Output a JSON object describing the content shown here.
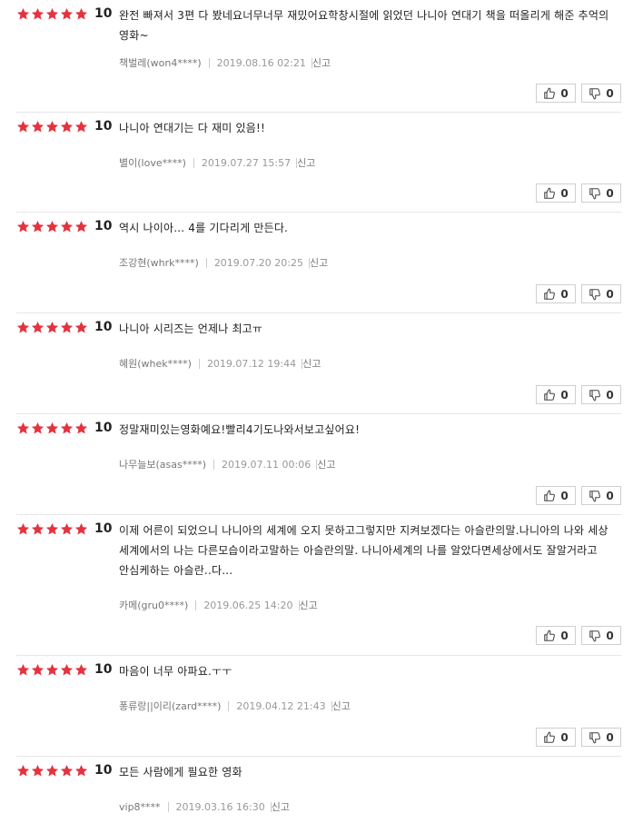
{
  "colors": {
    "star": "#e4333f",
    "score": "#222222",
    "text": "#222222",
    "meta": "#777777",
    "border": "#e6e6e6"
  },
  "reviews": [
    {
      "stars": 5,
      "score": "10",
      "text": "완전 빠져서 3편 다 봤네요너무너무 재밌어요학창시절에 읽었던 나니아 연대기 책을 떠올리게 해준 추억의 영화~",
      "user": "책벌레(won4****)",
      "date": "2019.08.16 02:21",
      "report": "신고",
      "likes": "0",
      "dislikes": "0"
    },
    {
      "stars": 5,
      "score": "10",
      "text": "나니아 연대기는 다 재미 있음!!",
      "user": "별이(love****)",
      "date": "2019.07.27 15:57",
      "report": "신고",
      "likes": "0",
      "dislikes": "0"
    },
    {
      "stars": 5,
      "score": "10",
      "text": "역시 나이아... 4를 기다리게 만든다.",
      "user": "조강현(whrk****)",
      "date": "2019.07.20 20:25",
      "report": "신고",
      "likes": "0",
      "dislikes": "0"
    },
    {
      "stars": 5,
      "score": "10",
      "text": "나니아 시리즈는 언제나 최고ㅠ",
      "user": "혜원(whek****)",
      "date": "2019.07.12 19:44",
      "report": "신고",
      "likes": "0",
      "dislikes": "0"
    },
    {
      "stars": 5,
      "score": "10",
      "text": "정말재미있는영화예요!빨리4기도나와서보고싶어요!",
      "user": "나무늘보(asas****)",
      "date": "2019.07.11 00:06",
      "report": "신고",
      "likes": "0",
      "dislikes": "0"
    },
    {
      "stars": 5,
      "score": "10",
      "text": "이제 어른이 되었으니 나니아의 세계에 오지 못하고그렇지만 지켜보겠다는 아슬란의말.나니아의 나와 세상세계에서의 나는 다른모습이라고말하는 아슬란의말. 나니아세계의 나를 알았다면세상에서도 잘알거라고 안심케하는 아슬란..다...",
      "user": "카메(gru0****)",
      "date": "2019.06.25 14:20",
      "report": "신고",
      "likes": "0",
      "dislikes": "0"
    },
    {
      "stars": 5,
      "score": "10",
      "text": "마음이 너무 아파요.ㅜㅜ",
      "user": "퐁류랑||이리(zard****)",
      "date": "2019.04.12 21:43",
      "report": "신고",
      "likes": "0",
      "dislikes": "0"
    },
    {
      "stars": 5,
      "score": "10",
      "text": "모든 사람에게 필요한 영화",
      "user": "vip8****",
      "date": "2019.03.16 16:30",
      "report": "신고"
    }
  ]
}
